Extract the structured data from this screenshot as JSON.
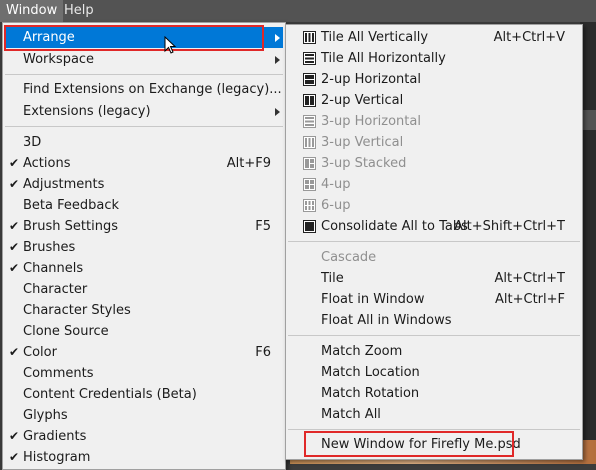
{
  "menubar": {
    "window": "Window",
    "help": "Help"
  },
  "main_menu": {
    "arrange": "Arrange",
    "workspace": "Workspace",
    "find_extensions": "Find Extensions on Exchange (legacy)...",
    "extensions_legacy": "Extensions (legacy)",
    "panels": [
      {
        "label": "3D",
        "checked": false,
        "shortcut": ""
      },
      {
        "label": "Actions",
        "checked": true,
        "shortcut": "Alt+F9"
      },
      {
        "label": "Adjustments",
        "checked": true,
        "shortcut": ""
      },
      {
        "label": "Beta Feedback",
        "checked": false,
        "shortcut": ""
      },
      {
        "label": "Brush Settings",
        "checked": true,
        "shortcut": "F5"
      },
      {
        "label": "Brushes",
        "checked": true,
        "shortcut": ""
      },
      {
        "label": "Channels",
        "checked": true,
        "shortcut": ""
      },
      {
        "label": "Character",
        "checked": false,
        "shortcut": ""
      },
      {
        "label": "Character Styles",
        "checked": false,
        "shortcut": ""
      },
      {
        "label": "Clone Source",
        "checked": false,
        "shortcut": ""
      },
      {
        "label": "Color",
        "checked": true,
        "shortcut": "F6"
      },
      {
        "label": "Comments",
        "checked": false,
        "shortcut": ""
      },
      {
        "label": "Content Credentials (Beta)",
        "checked": false,
        "shortcut": ""
      },
      {
        "label": "Glyphs",
        "checked": false,
        "shortcut": ""
      },
      {
        "label": "Gradients",
        "checked": true,
        "shortcut": ""
      },
      {
        "label": "Histogram",
        "checked": true,
        "shortcut": ""
      }
    ],
    "checkmark": "✔"
  },
  "arrange_submenu": {
    "tile_all_vertically": {
      "label": "Tile All Vertically",
      "shortcut": "Alt+Ctrl+V"
    },
    "tile_all_horizontally": {
      "label": "Tile All Horizontally"
    },
    "two_up_horizontal": {
      "label": "2-up Horizontal"
    },
    "two_up_vertical": {
      "label": "2-up Vertical"
    },
    "three_up_horizontal": {
      "label": "3-up Horizontal"
    },
    "three_up_vertical": {
      "label": "3-up Vertical"
    },
    "three_up_stacked": {
      "label": "3-up Stacked"
    },
    "four_up": {
      "label": "4-up"
    },
    "six_up": {
      "label": "6-up"
    },
    "consolidate": {
      "label": "Consolidate All to Tabs",
      "shortcut": "Alt+Shift+Ctrl+T"
    },
    "cascade": {
      "label": "Cascade"
    },
    "tile": {
      "label": "Tile",
      "shortcut": "Alt+Ctrl+T"
    },
    "float_in_window": {
      "label": "Float in Window",
      "shortcut": "Alt+Ctrl+F"
    },
    "float_all": {
      "label": "Float All in Windows"
    },
    "match_zoom": {
      "label": "Match Zoom"
    },
    "match_location": {
      "label": "Match Location"
    },
    "match_rotation": {
      "label": "Match Rotation"
    },
    "match_all": {
      "label": "Match All"
    },
    "new_window": {
      "label": "New Window for Firefly Me.psd"
    }
  },
  "colors": {
    "highlight": "#0078d7",
    "callout": "#e02828",
    "menu_bg": "#f0f0f0",
    "disabled": "#8f8f8f"
  }
}
